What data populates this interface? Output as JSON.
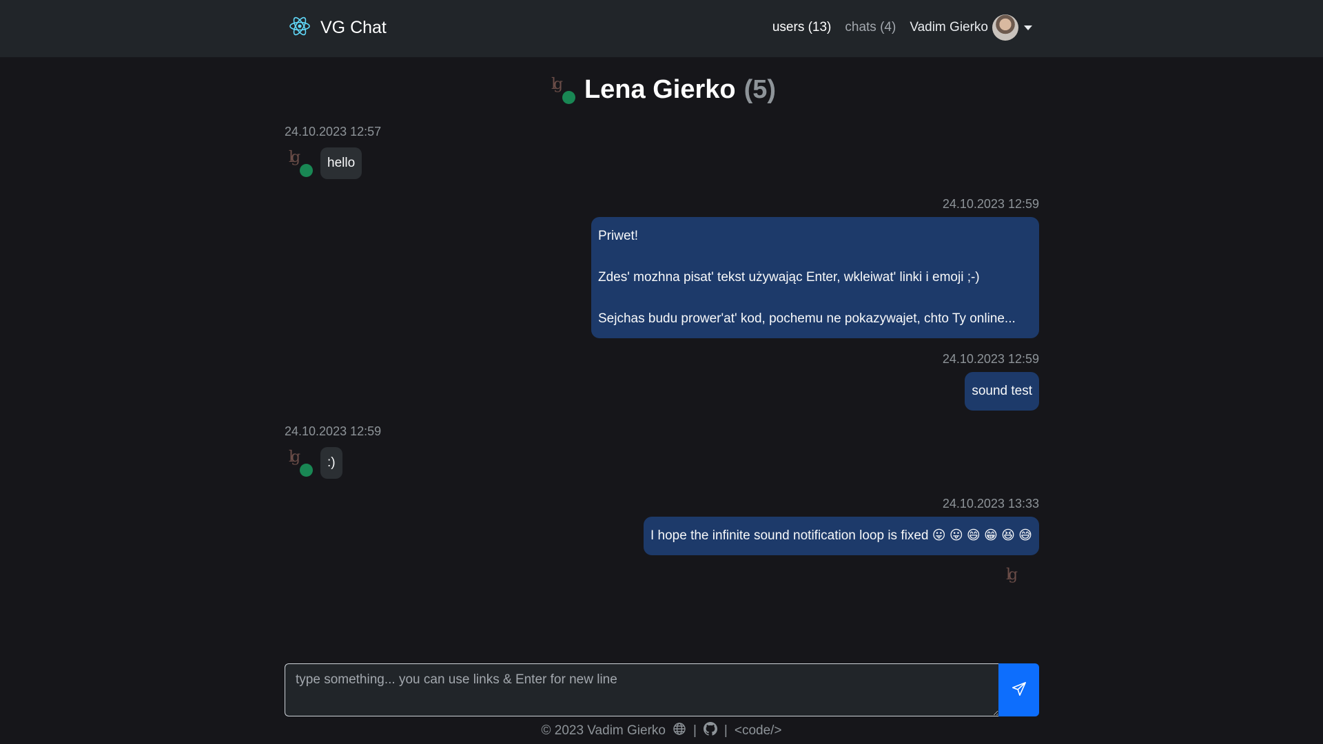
{
  "nav": {
    "brand": "VG Chat",
    "users_link": "users (13)",
    "chats_link": "chats (4)",
    "user_name": "Vadim Gierko"
  },
  "chat": {
    "title": "Lena Gierko",
    "count": "(5)"
  },
  "messages": [
    {
      "direction": "in",
      "time": "24.10.2023 12:57",
      "lines": [
        "hello"
      ]
    },
    {
      "direction": "out",
      "time": "24.10.2023 12:59",
      "lines": [
        "Priwet!",
        "",
        "Zdes' mozhna pisat' tekst używając Enter, wkleiwat' linki i emoji ;-)",
        "",
        "Sejchas budu prower'at' kod, pochemu ne pokazywajet, chto Ty online..."
      ]
    },
    {
      "direction": "out",
      "time": "24.10.2023 12:59",
      "lines": [
        "sound test"
      ]
    },
    {
      "direction": "in",
      "time": "24.10.2023 12:59",
      "lines": [
        ":)"
      ]
    },
    {
      "direction": "out",
      "time": "24.10.2023 13:33",
      "lines": [
        "I hope the infinite sound notification loop is fixed 😛 😛 😄 😁 😆 😅"
      ]
    }
  ],
  "composer": {
    "placeholder": "type something... you can use links & Enter for new line"
  },
  "footer": {
    "copyright": "© 2023 Vadim Gierko",
    "sep1": "|",
    "sep2": "|",
    "code_link": "<code/>"
  },
  "colors": {
    "navbar": "#212529",
    "background": "#16161a",
    "bubble_out": "#1d3a6a",
    "bubble_in": "#2b2f33",
    "online": "#198754",
    "send": "#0d6efd"
  }
}
